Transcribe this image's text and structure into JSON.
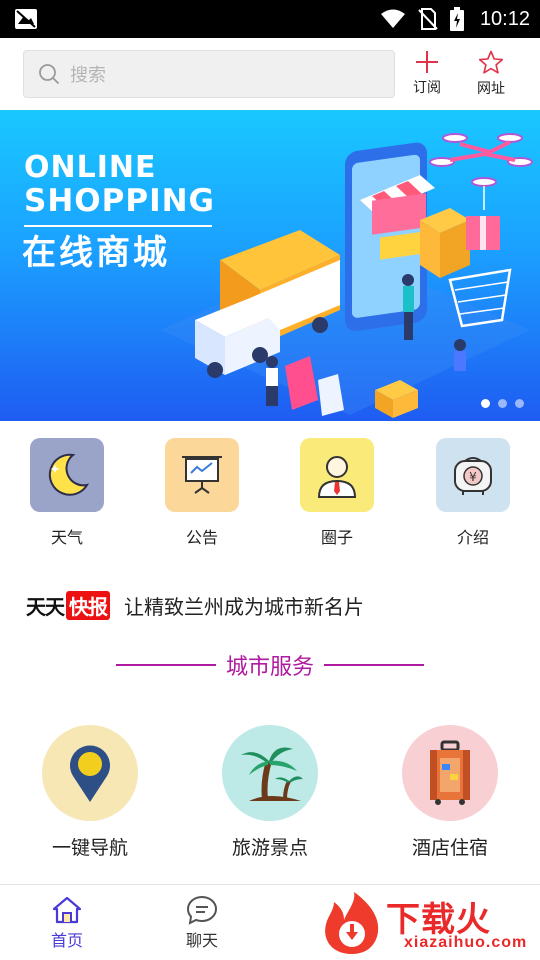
{
  "status_bar": {
    "time": "10:12"
  },
  "header": {
    "search_placeholder": "搜索",
    "subscribe_label": "订阅",
    "website_label": "网址"
  },
  "banner": {
    "line1": "ONLINE",
    "line2": "SHOPPING",
    "line3": "在线商城",
    "slide_count": 3,
    "active_slide": 1
  },
  "quick_menu": [
    {
      "label": "天气",
      "icon": "moon-icon",
      "color": "#9aa3c8"
    },
    {
      "label": "公告",
      "icon": "presentation-icon",
      "color": "#fbd79a"
    },
    {
      "label": "圈子",
      "icon": "person-icon",
      "color": "#f9ea7a"
    },
    {
      "label": "介绍",
      "icon": "money-bag-icon",
      "color": "#cfe2ef"
    }
  ],
  "news": {
    "brand_a": "天天",
    "brand_b": "快报",
    "headline": "让精致兰州成为城市新名片"
  },
  "section": {
    "title": "城市服务",
    "accent": "#b01aa0"
  },
  "services": [
    {
      "label": "一键导航",
      "icon": "location-pin-icon",
      "color": "#f6e7b5"
    },
    {
      "label": "旅游景点",
      "icon": "palm-tree-icon",
      "color": "#bde9e7"
    },
    {
      "label": "酒店住宿",
      "icon": "luggage-icon",
      "color": "#f8cfd3"
    }
  ],
  "bottom_nav": {
    "home_label": "首页",
    "chat_label": "聊天"
  },
  "watermark": {
    "text": "下载火",
    "url": "xiazaihuo.com"
  }
}
